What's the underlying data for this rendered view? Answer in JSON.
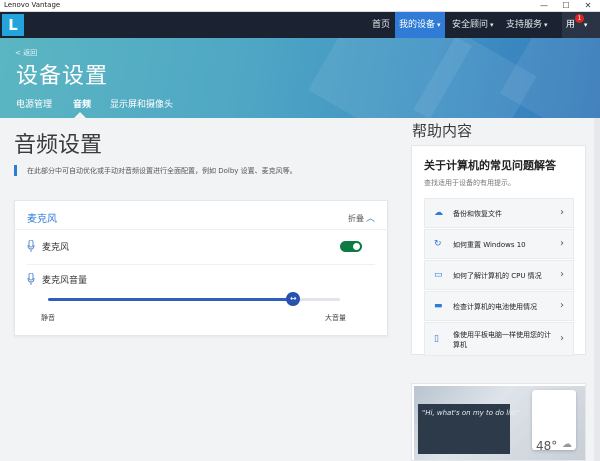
{
  "window": {
    "title": "Lenovo Vantage",
    "minimize": "—",
    "maximize": "☐",
    "close": "✕"
  },
  "nav": {
    "logo": "L",
    "items": [
      {
        "label": "首页",
        "caret": ""
      },
      {
        "label": "我的设备",
        "caret": "▾"
      },
      {
        "label": "安全顾问",
        "caret": "▾"
      },
      {
        "label": "支持服务",
        "caret": "▾"
      }
    ],
    "user": {
      "label": "用",
      "caret": "▾",
      "badge": "1"
    }
  },
  "hero": {
    "back": "< 返回",
    "title": "设备设置",
    "tabs": [
      "电源管理",
      "音频",
      "显示屏和摄像头"
    ]
  },
  "section": {
    "title": "音频设置",
    "description": "在此部分中可自动优化或手动对音频设置进行全面配置，例如 Dolby 设置、麦克风等。"
  },
  "mic_card": {
    "title": "麦克风",
    "collapse": "折叠",
    "collapse_icon": "chevron-up-icon",
    "mic_label": "麦克风",
    "mic_enabled": true,
    "volume_label": "麦克风音量",
    "volume_level": 0.84,
    "volume_min": "静音",
    "volume_max": "大音量",
    "thumb_glyph": "↔",
    "chevron": "︿"
  },
  "help": {
    "title": "帮助内容",
    "faq_title": "关于计算机的常见问题解答",
    "faq_subtitle": "查找适用于设备的有用提示。",
    "items": [
      {
        "icon": "☁",
        "label": "备份和恢复文件"
      },
      {
        "icon": "↻",
        "label": "如何重置 Windows 10"
      },
      {
        "icon": "▭",
        "label": "如何了解计算机的 CPU 情况"
      },
      {
        "icon": "▬",
        "label": "检查计算机的电池使用情况"
      },
      {
        "icon": "▯",
        "label": "像使用平板电脑一样使用您的计算机"
      }
    ],
    "item_chevron": "›"
  },
  "promo": {
    "quote": "\"Hi, what's on my to do list\"",
    "temperature": "48°",
    "weather_icon": "☁"
  },
  "colors": {
    "accent": "#2f7bd6",
    "nav_bg": "#1b2332",
    "toggle_on": "#0d7a44"
  }
}
